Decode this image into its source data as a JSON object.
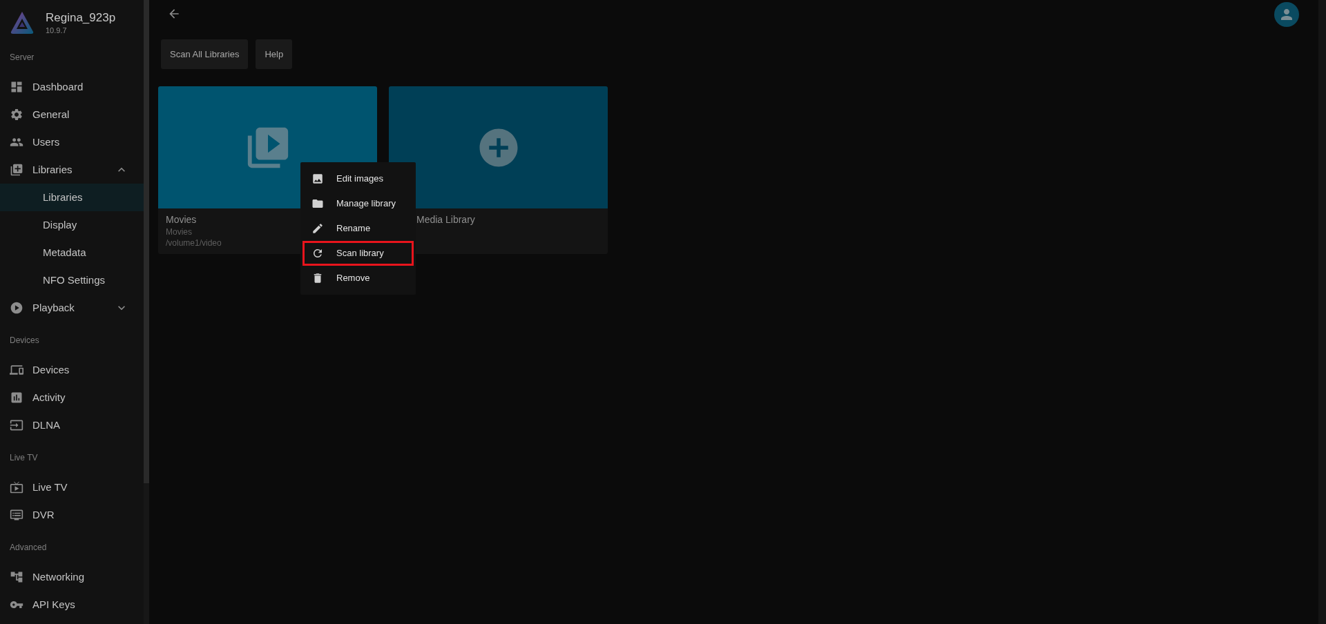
{
  "sidebar": {
    "server_name": "Regina_923p",
    "version": "10.9.7",
    "sections": [
      {
        "heading": "Server",
        "items": [
          {
            "label": "Dashboard",
            "selected": false
          },
          {
            "label": "General",
            "selected": false
          },
          {
            "label": "Users",
            "selected": false
          },
          {
            "label": "Libraries",
            "selected": false,
            "expanded": true,
            "children": [
              {
                "label": "Libraries",
                "selected": true
              },
              {
                "label": "Display",
                "selected": false
              },
              {
                "label": "Metadata",
                "selected": false
              },
              {
                "label": "NFO Settings",
                "selected": false
              }
            ]
          },
          {
            "label": "Playback",
            "selected": false,
            "expanded": false
          }
        ]
      },
      {
        "heading": "Devices",
        "items": [
          {
            "label": "Devices",
            "selected": false
          },
          {
            "label": "Activity",
            "selected": false
          },
          {
            "label": "DLNA",
            "selected": false
          }
        ]
      },
      {
        "heading": "Live TV",
        "items": [
          {
            "label": "Live TV",
            "selected": false
          },
          {
            "label": "DVR",
            "selected": false
          }
        ]
      },
      {
        "heading": "Advanced",
        "items": [
          {
            "label": "Networking",
            "selected": false
          },
          {
            "label": "API Keys",
            "selected": false
          }
        ]
      }
    ]
  },
  "toolbar": {
    "buttons": [
      "Scan All Libraries",
      "Help"
    ]
  },
  "libraries": [
    {
      "kind": "library",
      "name": "Movies",
      "type": "Movies",
      "path": "/volume1/video"
    },
    {
      "kind": "add",
      "name": "Media Library"
    }
  ],
  "context_menu": {
    "items": [
      {
        "label": "Edit images",
        "highlighted": false
      },
      {
        "label": "Manage library",
        "highlighted": false
      },
      {
        "label": "Rename",
        "highlighted": false
      },
      {
        "label": "Scan library",
        "highlighted": true
      },
      {
        "label": "Remove",
        "highlighted": false
      }
    ]
  }
}
